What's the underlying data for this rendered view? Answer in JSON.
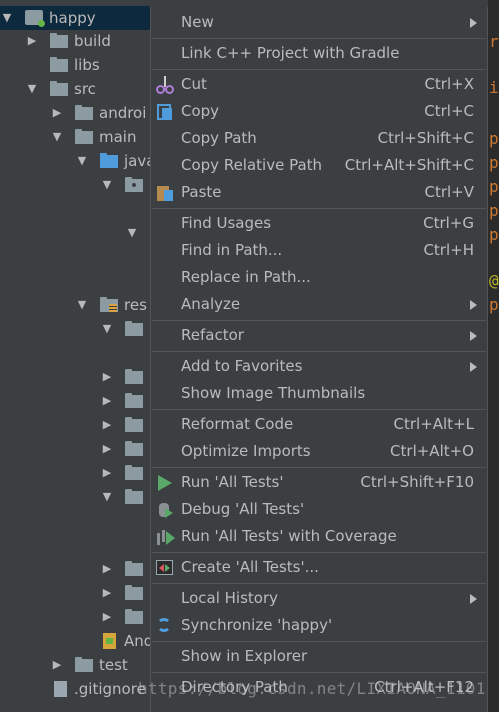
{
  "tree": {
    "root_label": "happy",
    "items": [
      {
        "label": "build"
      },
      {
        "label": "libs"
      },
      {
        "label": "src"
      },
      {
        "label": "androi"
      },
      {
        "label": "main"
      },
      {
        "label": "java"
      },
      {
        "label": "res"
      },
      {
        "label": "And"
      },
      {
        "label": "test"
      },
      {
        "label": ".gitignore"
      }
    ]
  },
  "menu": {
    "items": [
      {
        "label": "New",
        "shortcut": "",
        "submenu": true
      },
      {
        "label": "Link C++ Project with Gradle",
        "shortcut": ""
      },
      {
        "label": "Cut",
        "shortcut": "Ctrl+X",
        "icon": "scissors-icon"
      },
      {
        "label": "Copy",
        "shortcut": "Ctrl+C",
        "icon": "copy-icon"
      },
      {
        "label": "Copy Path",
        "shortcut": "Ctrl+Shift+C"
      },
      {
        "label": "Copy Relative Path",
        "shortcut": "Ctrl+Alt+Shift+C"
      },
      {
        "label": "Paste",
        "shortcut": "Ctrl+V",
        "icon": "paste-icon"
      },
      {
        "label": "Find Usages",
        "shortcut": "Ctrl+G"
      },
      {
        "label": "Find in Path...",
        "shortcut": "Ctrl+H"
      },
      {
        "label": "Replace in Path...",
        "shortcut": ""
      },
      {
        "label": "Analyze",
        "shortcut": "",
        "submenu": true
      },
      {
        "label": "Refactor",
        "shortcut": "",
        "submenu": true
      },
      {
        "label": "Add to Favorites",
        "shortcut": "",
        "submenu": true
      },
      {
        "label": "Show Image Thumbnails",
        "shortcut": ""
      },
      {
        "label": "Reformat Code",
        "shortcut": "Ctrl+Alt+L"
      },
      {
        "label": "Optimize Imports",
        "shortcut": "Ctrl+Alt+O"
      },
      {
        "label": "Run 'All Tests'",
        "shortcut": "Ctrl+Shift+F10",
        "icon": "run-icon"
      },
      {
        "label": "Debug 'All Tests'",
        "shortcut": "",
        "icon": "debug-icon"
      },
      {
        "label": "Run 'All Tests' with Coverage",
        "shortcut": "",
        "icon": "coverage-icon"
      },
      {
        "label": "Create 'All Tests'...",
        "shortcut": "",
        "icon": "create-test-icon"
      },
      {
        "label": "Local History",
        "shortcut": "",
        "submenu": true
      },
      {
        "label": "Synchronize 'happy'",
        "shortcut": "",
        "icon": "sync-icon"
      },
      {
        "label": "Show in Explorer",
        "shortcut": ""
      },
      {
        "label": "Directory Path",
        "shortcut": "Ctrl+Alt+F12"
      }
    ]
  },
  "editor": {
    "gutter_chars": [
      "r",
      "i",
      "p",
      "p",
      "p",
      "p",
      "p",
      "@",
      "p"
    ]
  },
  "watermark": "https://blog.csdn.net/LIXIAONA_1101",
  "colors": {
    "menu_bg": "#3c3f41",
    "selection_bg": "#0d293e",
    "folder_blue": "#4e9cdc",
    "run_green": "#59a869",
    "gutter_orange": "#cc7832"
  }
}
